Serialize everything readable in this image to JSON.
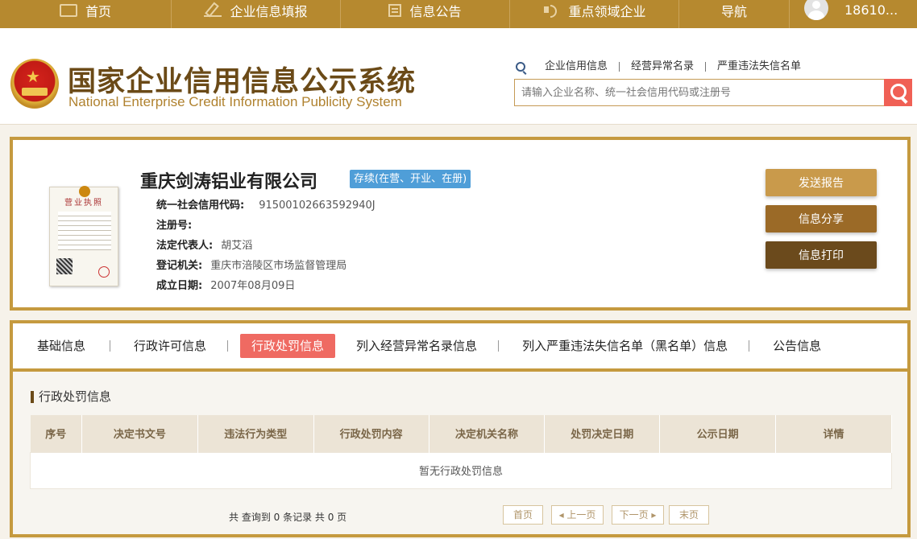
{
  "topnav": {
    "items": [
      {
        "label": "首页",
        "icon": "monitor-icon"
      },
      {
        "label": "企业信息填报",
        "icon": "pen-icon"
      },
      {
        "label": "信息公告",
        "icon": "document-icon"
      },
      {
        "label": "重点领域企业",
        "icon": "speaker-icon"
      },
      {
        "label": "导航"
      }
    ],
    "user": "18610..."
  },
  "header": {
    "title_cn": "国家企业信用信息公示系统",
    "title_en": "National Enterprise Credit Information Publicity System",
    "links": [
      "企业信用信息",
      "经营异常名录",
      "严重违法失信名单"
    ],
    "search_placeholder": "请输入企业名称、统一社会信用代码或注册号"
  },
  "company": {
    "name": "重庆剑涛铝业有限公司",
    "status": "存续(在营、开业、在册)",
    "license_title": "营业执照",
    "fields": [
      {
        "label": "统一社会信用代码:",
        "value": "91500102663592940J"
      },
      {
        "label": "注册号:",
        "value": ""
      },
      {
        "label": "法定代表人:",
        "value": "胡艾滔"
      },
      {
        "label": "登记机关:",
        "value": "重庆市涪陵区市场监督管理局"
      },
      {
        "label": "成立日期:",
        "value": "2007年08月09日"
      }
    ],
    "buttons": [
      {
        "label": "发送报告",
        "color": "#c99a4b"
      },
      {
        "label": "信息分享",
        "color": "#9b6a27"
      },
      {
        "label": "信息打印",
        "color": "#6b4a1c"
      }
    ]
  },
  "tabs": {
    "items": [
      "基础信息",
      "行政许可信息",
      "行政处罚信息",
      "列入经营异常名录信息",
      "列入严重违法失信名单（黑名单）信息",
      "公告信息"
    ],
    "active_index": 2
  },
  "panel": {
    "section_title": "行政处罚信息",
    "columns": [
      "序号",
      "决定书文号",
      "违法行为类型",
      "行政处罚内容",
      "决定机关名称",
      "处罚决定日期",
      "公示日期",
      "详情"
    ],
    "empty_text": "暂无行政处罚信息",
    "pager_info": "共 查询到 0 条记录 共 0 页",
    "pager": {
      "first": "首页",
      "prev": "上一页",
      "next": "下一页",
      "last": "末页"
    }
  },
  "colors": {
    "brand": "#b6892f",
    "border": "#c59a3f",
    "active_tab": "#ef6a62",
    "status": "#4f9ed8",
    "search_button": "#f06055"
  }
}
